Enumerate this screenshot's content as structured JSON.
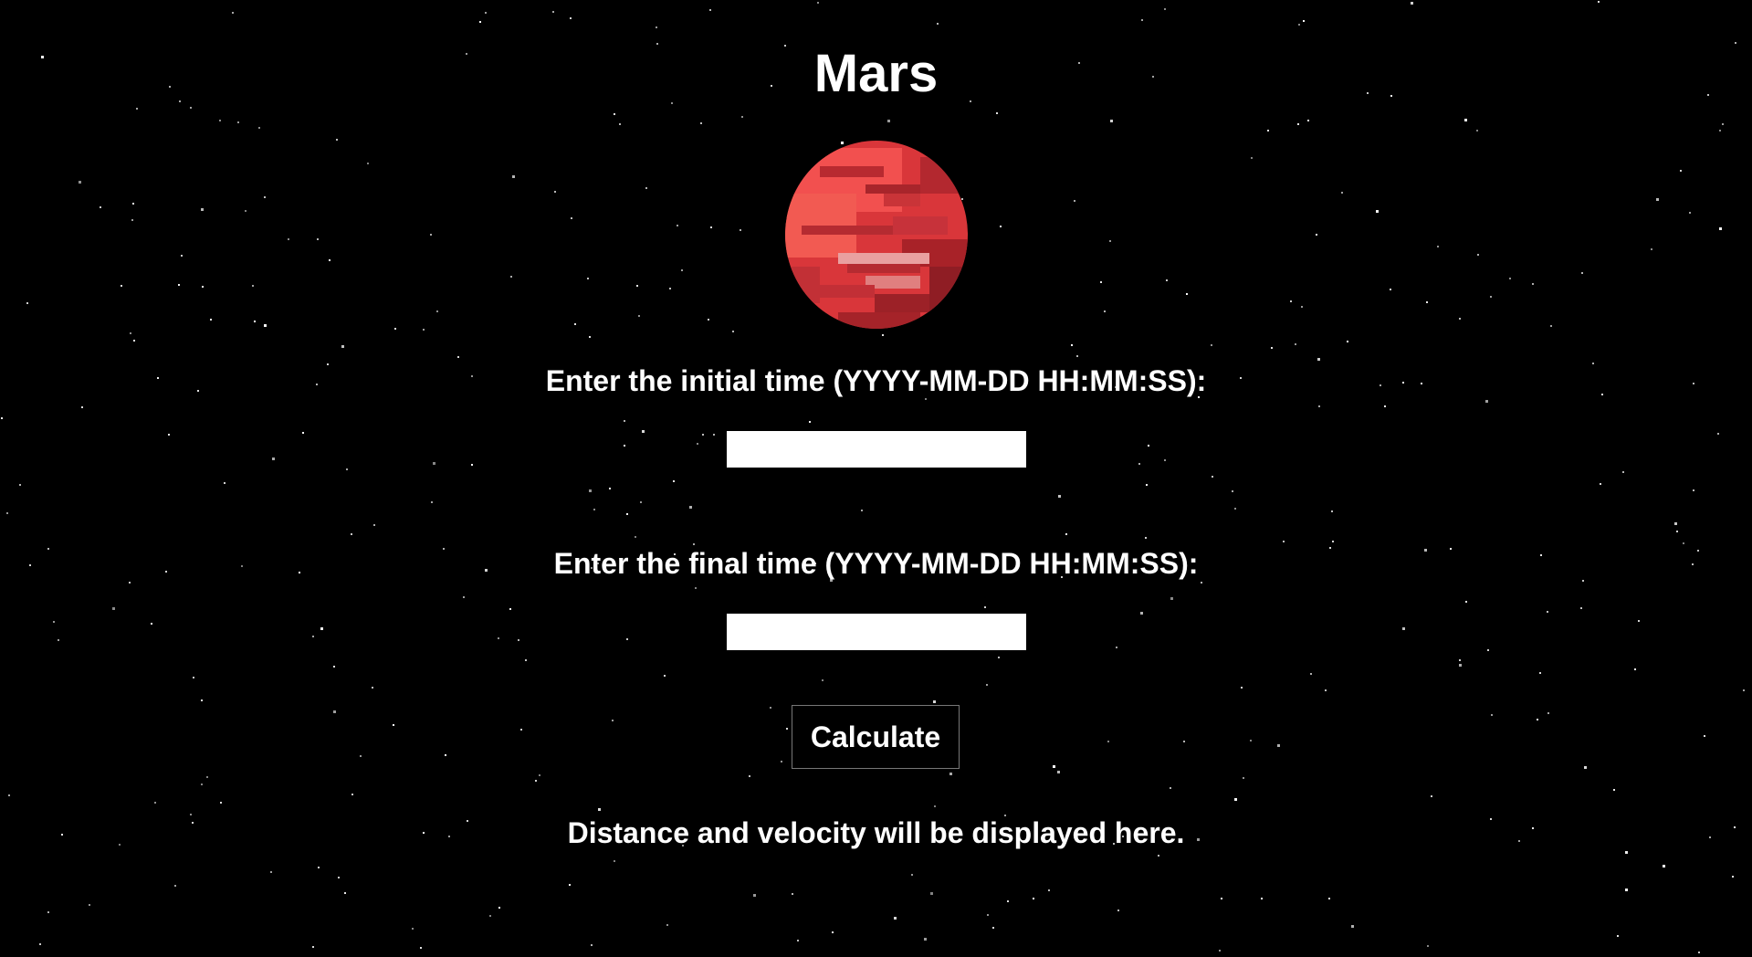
{
  "page": {
    "title": "Mars",
    "background_color": "#000000",
    "planet_image": "mars-pixel-art",
    "planet_color": "#d9363a"
  },
  "form": {
    "initial_label": "Enter the initial time (YYYY-MM-DD HH:MM:SS):",
    "initial_value": "",
    "final_label": "Enter the final time (YYYY-MM-DD HH:MM:SS):",
    "final_value": "",
    "calculate_label": "Calculate"
  },
  "result": {
    "text": "Distance and velocity will be displayed here."
  }
}
